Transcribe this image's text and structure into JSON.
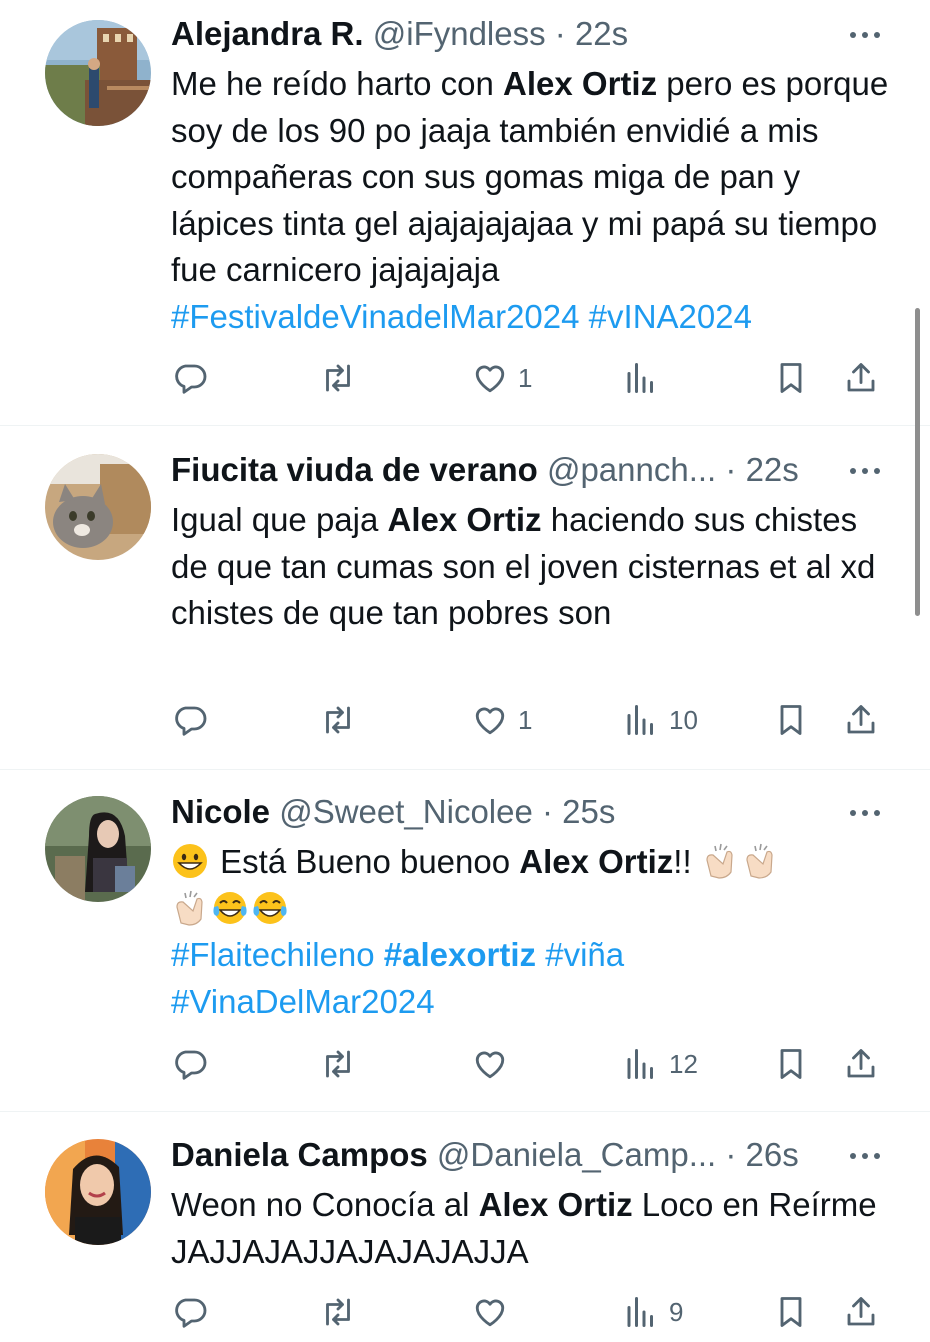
{
  "tweets": [
    {
      "name": "Alejandra R.",
      "handle": "@iFyndless",
      "sep": " · ",
      "time": "22s",
      "text_parts": [
        "Me he reído harto con ",
        "Alex Ortiz",
        " pero es porque soy de los 90 po jaaja también envidié a mis compañeras con sus gomas miga de pan y lápices tinta gel ajajajajajaa y mi papá su tiempo fue carnicero jajajajaja"
      ],
      "hashtags": [
        "#FestivaldeVinadelMar2024",
        "#vINA2024"
      ],
      "likes": "1",
      "views": ""
    },
    {
      "name": "Fiucita viuda de verano",
      "handle": "@pannch...",
      "sep": " · ",
      "time": "22s",
      "text_parts": [
        "Igual que paja ",
        "Alex Ortiz",
        " haciendo sus chistes de que tan cumas son el joven cisternas et al xd chistes de que tan pobres son"
      ],
      "likes": "1",
      "views": "10"
    },
    {
      "name": "Nicole",
      "handle": "@Sweet_Nicolee",
      "sep": " · ",
      "time": "25s",
      "text_parts": [
        " Está Bueno buenoo ",
        "Alex Ortiz",
        "!! "
      ],
      "hashtags": [
        "#Flaitechileno",
        "#alexortiz",
        "#viña",
        "#VinaDelMar2024"
      ],
      "likes": "",
      "views": "12"
    },
    {
      "name": "Daniela Campos",
      "handle": "@Daniela_Camp...",
      "sep": " · ",
      "time": "26s",
      "text_parts": [
        "Weon no Conocía al ",
        "Alex Ortiz",
        " Loco en Reírme  JAJJAJAJJAJAJAJAJJA"
      ],
      "likes": "",
      "views": "9"
    }
  ],
  "icons": {
    "reply": "reply-icon",
    "retweet": "retweet-icon",
    "like": "heart-icon",
    "views": "views-icon",
    "bookmark": "bookmark-icon",
    "share": "share-icon",
    "more": "more-icon"
  },
  "colors": {
    "link": "#1d9bf0",
    "muted": "#536471",
    "text": "#0f1419"
  }
}
